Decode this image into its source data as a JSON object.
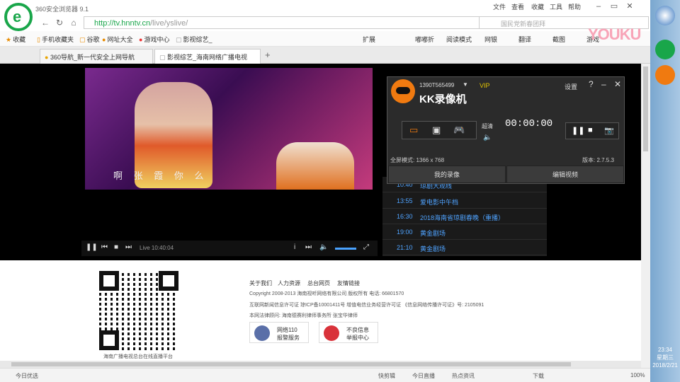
{
  "browser": {
    "app_title": "360安全浏览器 9.1",
    "menu": [
      "文件",
      "查看",
      "收藏",
      "工具",
      "帮助"
    ],
    "url_host": "http://tv.hnntv.cn",
    "url_path": "/live/yslive/",
    "search_placeholder": "国民党新春团拜",
    "favorites": [
      "收藏",
      "手机收藏夹",
      "谷歌",
      "网址大全",
      "游戏中心",
      "影视综艺_"
    ],
    "toolbar_right": [
      "扩展",
      "嘟嘟折",
      "阅读模式",
      "网银",
      "翻译",
      "截图",
      "游戏"
    ],
    "tabs": [
      {
        "label": "360导航_新一代安全上网导航"
      },
      {
        "label": "影视综艺_海南网络广播电视"
      }
    ]
  },
  "watermark": "YOUKU",
  "player": {
    "subtitle": "啊   张  霞  你  么",
    "live_label": "Live  10:40:04"
  },
  "schedule": [
    {
      "time": "10:40",
      "name": "琼剧大观线"
    },
    {
      "time": "13:55",
      "name": "爱电影中午档"
    },
    {
      "time": "16:30",
      "name": "2018海南省琼剧春晚（重播）"
    },
    {
      "time": "19:00",
      "name": "黄金剧场"
    },
    {
      "time": "21:10",
      "name": "黄金剧场"
    }
  ],
  "kk": {
    "qq": "1390T565499",
    "vip": "VIP",
    "name": "KK录像机",
    "settings": "设置",
    "quality": "超清",
    "timer": "00:00:00",
    "resolution": "全屏模式: 1366 x 768",
    "version": "版本: 2.7.5.3",
    "my_recordings": "我的录像",
    "edit_video": "编辑视频"
  },
  "footer": {
    "links": [
      "关于我们",
      "人力资源",
      "总台网页",
      "友情链接"
    ],
    "copyright": "Copyright 2008-2013 海南视听网络有限公司 版权所有 电话: 66801570",
    "license": "互联网新闻信息许可证 琼ICP备10001411号 增值电信业务经营许可证 《信息网络传播许可证》号: 2105091",
    "law": "本网法律顾问: 海南德赛利律师事务所  张宝华律师",
    "qr_caption": "海南广播电视总台在线直播平台",
    "badge1": [
      "网络110",
      "报警服务"
    ],
    "badge2": [
      "不良信息",
      "举报中心"
    ]
  },
  "status": {
    "left": "今日优选",
    "items": [
      "快剪辑",
      "今日直播",
      "热点资讯"
    ],
    "download": "下载",
    "zoom": "100%"
  },
  "clock": {
    "time": "23:34",
    "day": "星期三",
    "date": "2018/2/21"
  }
}
